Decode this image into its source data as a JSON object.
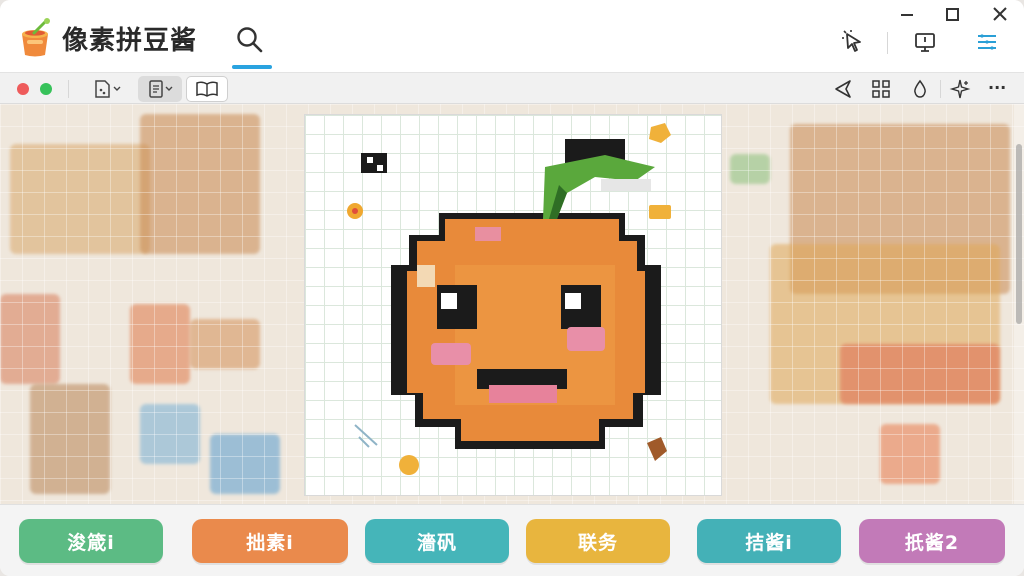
{
  "app": {
    "title": "像素拼豆酱",
    "icon": "bean-jar-icon"
  },
  "window_controls": [
    "minimize-icon",
    "maximize-icon",
    "close-icon"
  ],
  "titlebar_icons": [
    "search-icon",
    "magic-cursor-icon",
    "monitor-icon",
    "menu-icon"
  ],
  "toolbar": {
    "traffic_dots": [
      "#ee5b5b",
      "#37c25a"
    ],
    "left_tools": [
      "new-document-icon",
      "notes-list-icon",
      "book-icon"
    ],
    "right_tools": [
      "send-icon",
      "grid-icon",
      "drop-icon",
      "sparkle-icon",
      "more-icon"
    ],
    "more_label": "···"
  },
  "canvas": {
    "subject": "pixel-orange-character"
  },
  "actions": [
    {
      "label": "浚箴i",
      "color": "#5cbb84"
    },
    {
      "label": "拙素i",
      "color": "#ea8a4c"
    },
    {
      "label": "濇矾",
      "color": "#45b5b9"
    },
    {
      "label": "联务",
      "color": "#e8b53e"
    },
    {
      "label": "拮酱i",
      "color": "#44b1b7"
    },
    {
      "label": "扺酱2",
      "color": "#c27ab8"
    }
  ]
}
